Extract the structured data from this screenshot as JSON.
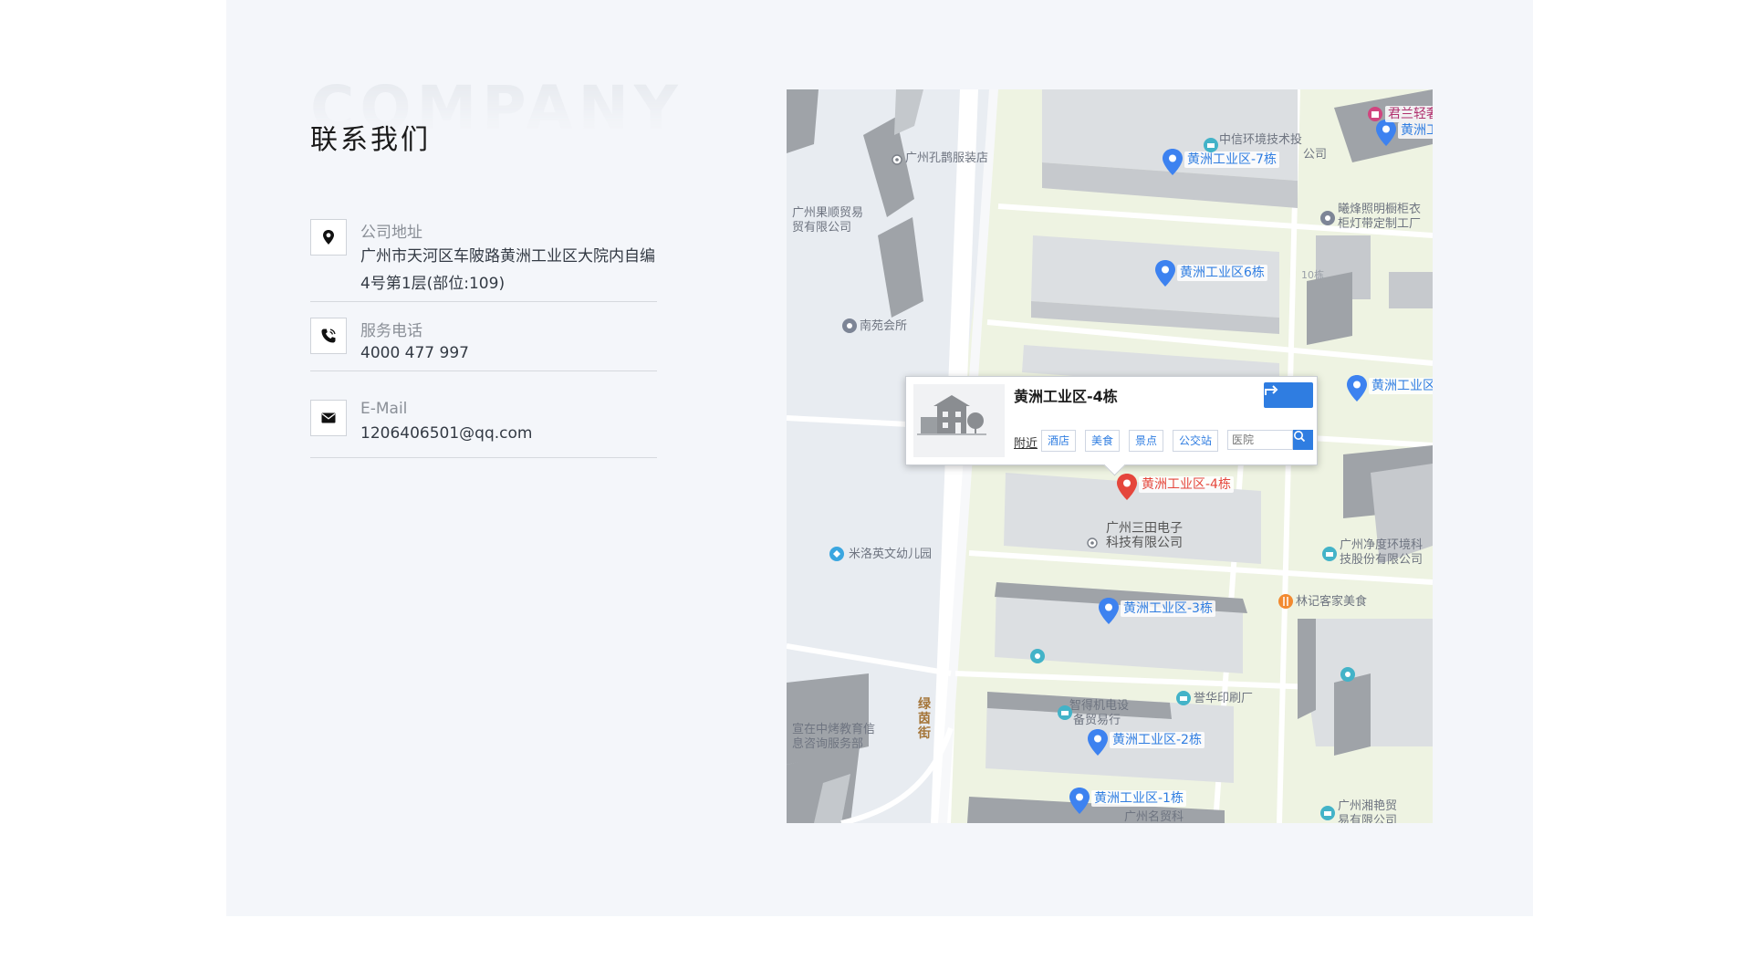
{
  "section": {
    "bg_word": "COMPANY",
    "title": "联系我们"
  },
  "contact": {
    "address_label": "公司地址",
    "address_line1": "广州市天河区车陂路黄洲工业区大院内自编",
    "address_line2": "4号第1层(部位:109)",
    "phone_label": "服务电话",
    "phone_value": "4000 477 997",
    "email_label": "E-Mail",
    "email_value": "1206406501@qq.com"
  },
  "icons": {
    "address": "location-pin-icon",
    "phone": "phone-icon",
    "email": "envelope-icon"
  },
  "map": {
    "popup": {
      "title": "黄洲工业区-4栋",
      "nearby_label": "附近",
      "tags": [
        "酒店",
        "美食",
        "景点",
        "公交站"
      ],
      "search_placeholder": "医院"
    },
    "pins": {
      "b7": "黄洲工业区-7栋",
      "b6": "黄洲工业区6栋",
      "b4": "黄洲工业区-4栋",
      "b3": "黄洲工业区-3栋",
      "b2": "黄洲工业区-2栋",
      "b1": "黄洲工业区-1栋",
      "right_top": "黄洲工",
      "right_mid": "黄洲工业区",
      "junlan": "君兰轻奢"
    },
    "places": {
      "kongque": "广州孔鹊服装店",
      "zhongxin1": "中信环境技术投",
      "zhongxin2": "公司",
      "xiyang1": "曦烽照明橱柜衣",
      "xiyang2": "柜灯带定制工厂",
      "guoshun1": "广州果顺贸易",
      "guoshun2": "贸有限公司",
      "nanyuan": "南苑会所",
      "santian1": "广州三田电子",
      "santian2": "科技有限公司",
      "miluo": "米洛英文幼儿园",
      "jingdu1": "广州净度环境科",
      "jingdu2": "技股份有限公司",
      "linji": "林记客家美食",
      "zhide1": "智得机电设",
      "zhide2": "备贸易行",
      "yuhua": "誉华印刷厂",
      "xuanzai1": "宣在中烤教育信",
      "xuanzai2": "息咨询服务部",
      "xiangyan1": "广州湘艳贸",
      "xiangyan2": "易有限公司",
      "lvyin": "绿茵街",
      "bld10": "10栋",
      "mingge": "广州名贸科"
    },
    "colors": {
      "pin_blue": "#3d82f0",
      "pin_red": "#e5463c",
      "block_green": "#eef3e2",
      "block_gray": "#d9dde2"
    }
  }
}
